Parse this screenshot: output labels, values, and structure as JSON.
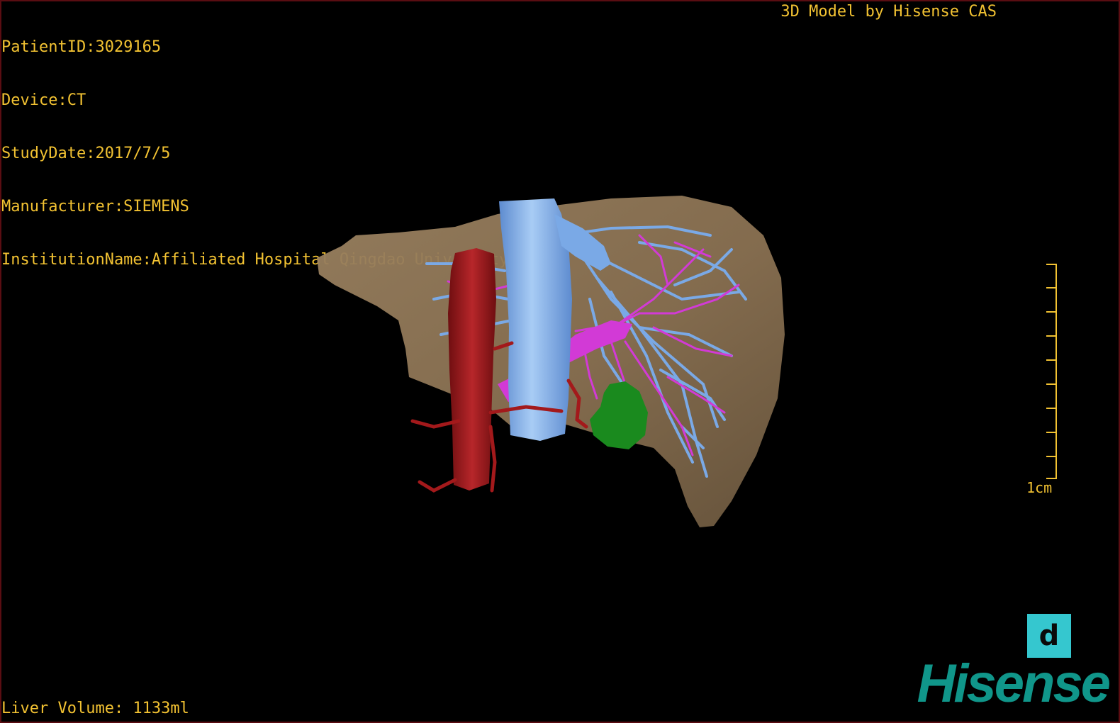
{
  "patient_info": {
    "patient_id": "PatientID:3029165",
    "device": "Device:CT",
    "study_date": "StudyDate:2017/7/5",
    "manufacturer": "Manufacturer:SIEMENS",
    "institution": "InstitutionName:Affiliated Hospital Qingdao University-C"
  },
  "credit": "3D Model by Hisense CAS",
  "liver_volume": "Liver Volume: 1133ml",
  "scale": {
    "label": "1cm"
  },
  "nav_button": {
    "label": "d"
  },
  "brand": "Hisense",
  "colors": {
    "overlay_text": "#f2c232",
    "liver": "#8a7152",
    "hepatic_vein": "#7aa9e6",
    "portal_vein": "#d23ad6",
    "artery_ivc": "#a3191b",
    "tumor": "#1a8a1e",
    "nav_button": "#35c7cf",
    "brand": "#10968a",
    "border": "#5a0d12"
  }
}
